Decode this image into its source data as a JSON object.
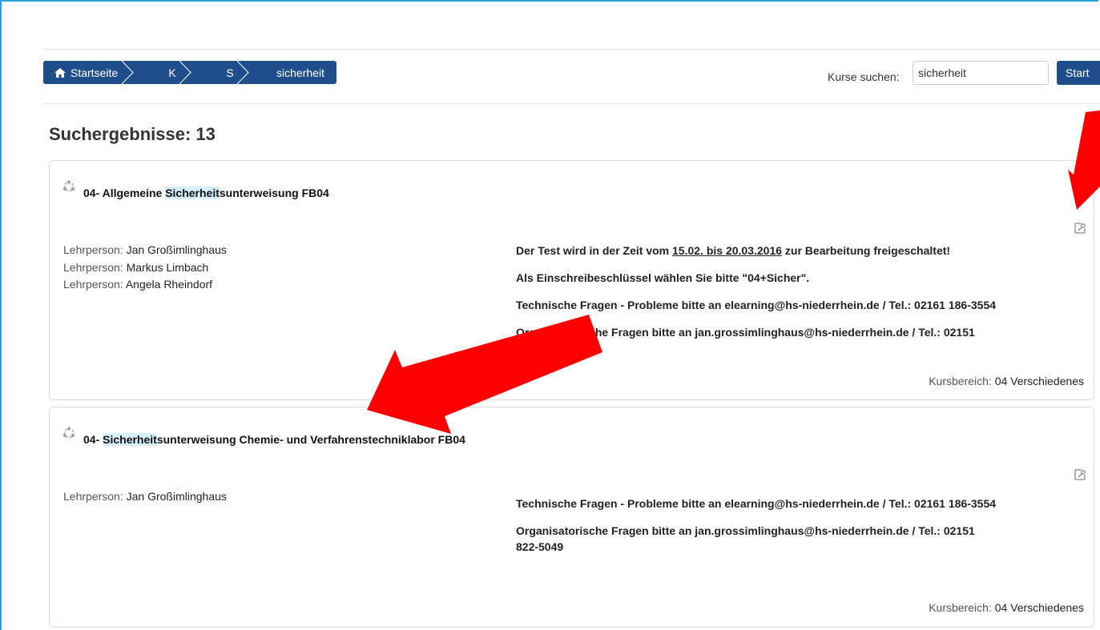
{
  "breadcrumb": {
    "home": "Startseite",
    "k": "K",
    "s": "S",
    "current": "sicherheit"
  },
  "search": {
    "label": "Kurse suchen:",
    "value": "sicherheit",
    "button": "Start"
  },
  "results_title": "Suchergebnisse: 13",
  "courses": [
    {
      "title_prefix": "04- Allgemeine ",
      "title_highlight": "Sicherheit",
      "title_suffix": "sunterweisung FB04",
      "teacher_label": "Lehrperson:",
      "teachers": [
        "Jan Großimlinghaus",
        "Markus Limbach",
        "Angela Rheindorf"
      ],
      "summary": {
        "line1_a": "Der Test wird in der Zeit vom ",
        "line1_b": "15.02. bis 20.03.2016",
        "line1_c": " zur Bearbeitung freigeschaltet!",
        "line2": "Als Einschreibeschlüssel wählen Sie bitte \"04+Sicher\".",
        "line3_a": "Technische Fragen - Probleme bitte an ",
        "line3_b": "elearning@hs-niederrhein.de",
        "line3_c": " / Tel.: 02161 186-3554",
        "line4_a": "Organisatorische Fragen bitte an ",
        "line4_b": "jan.grossimlinghaus@hs-niederrhein.de",
        "line4_c": " / Tel.: 02151"
      },
      "category_label": "Kursbereich:",
      "category": "04 Verschiedenes"
    },
    {
      "title_prefix": "04- ",
      "title_highlight": "Sicherheit",
      "title_suffix": "sunterweisung Chemie- und Verfahrenstechniklabor FB04",
      "teacher_label": "Lehrperson:",
      "teachers": [
        "Jan Großimlinghaus"
      ],
      "summary": {
        "line3_a": "Technische Fragen - Probleme bitte an ",
        "line3_b": "elearning@hs-niederrhein.de",
        "line3_c": " / Tel.: 02161 186-3554",
        "line4_a": "Organisatorische Fragen bitte an ",
        "line4_b": "jan.grossimlinghaus@hs-niederrhein.de",
        "line4_c": " / Tel.: 02151",
        "line4_d": "822-5049"
      },
      "category_label": "Kursbereich:",
      "category": "04 Verschiedenes"
    }
  ],
  "colors": {
    "nav_blue": "#1f4e8c",
    "highlight": "#d7eefc",
    "annotation_red": "#ff0000",
    "frame_blue": "#29a3e0"
  }
}
